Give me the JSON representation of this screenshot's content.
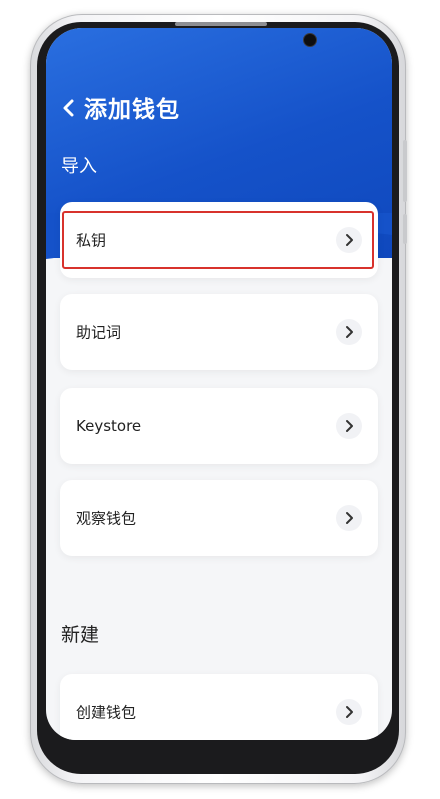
{
  "header": {
    "title": "添加钱包",
    "back_icon": "chevron-left-icon",
    "color_top": "#2a6fe0",
    "color_bottom": "#0f48bd"
  },
  "import_section": {
    "label": "导入",
    "items": [
      {
        "label": "私钥",
        "highlighted": true
      },
      {
        "label": "助记词"
      },
      {
        "label": "Keystore"
      },
      {
        "label": "观察钱包"
      }
    ]
  },
  "new_section": {
    "label": "新建",
    "items": [
      {
        "label": "创建钱包"
      }
    ]
  },
  "highlight_color": "#d8322c",
  "item_icon": "chevron-right-icon"
}
